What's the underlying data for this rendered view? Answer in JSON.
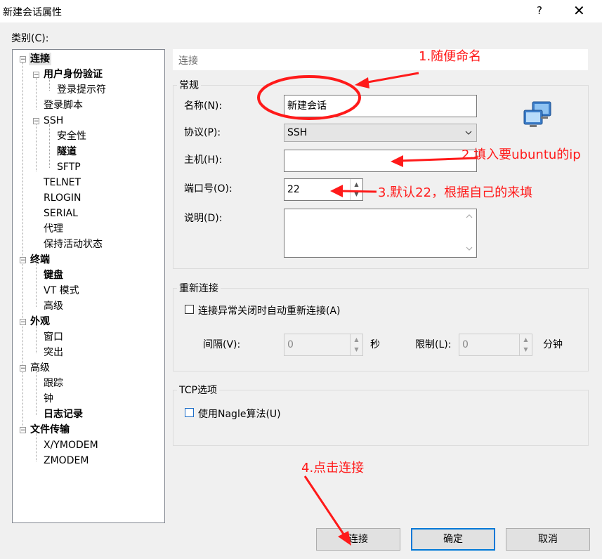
{
  "window": {
    "title": "新建会话属性",
    "help_glyph": "?",
    "close_glyph": "✕"
  },
  "category_label": "类别(C):",
  "tree": [
    {
      "label": "连接",
      "bold": true,
      "selected": true
    },
    {
      "label": "用户身份验证",
      "bold": true
    },
    {
      "label": "登录提示符"
    },
    {
      "label": "登录脚本"
    },
    {
      "label": "SSH"
    },
    {
      "label": "安全性"
    },
    {
      "label": "隧道",
      "bold": true
    },
    {
      "label": "SFTP"
    },
    {
      "label": "TELNET"
    },
    {
      "label": "RLOGIN"
    },
    {
      "label": "SERIAL"
    },
    {
      "label": "代理"
    },
    {
      "label": "保持活动状态"
    },
    {
      "label": "终端",
      "bold": true
    },
    {
      "label": "键盘",
      "bold": true
    },
    {
      "label": "VT 模式"
    },
    {
      "label": "高级"
    },
    {
      "label": "外观",
      "bold": true
    },
    {
      "label": "窗口"
    },
    {
      "label": "突出"
    },
    {
      "label": "高级"
    },
    {
      "label": "跟踪"
    },
    {
      "label": "钟"
    },
    {
      "label": "日志记录",
      "bold": true
    },
    {
      "label": "文件传输",
      "bold": true
    },
    {
      "label": "X/YMODEM"
    },
    {
      "label": "ZMODEM"
    }
  ],
  "panel_header": "连接",
  "general": {
    "title": "常规",
    "name_label": "名称(N):",
    "name_value": "新建会话",
    "protocol_label": "协议(P):",
    "protocol_value": "SSH",
    "host_label": "主机(H):",
    "host_value": "",
    "port_label": "端口号(O):",
    "port_value": "22",
    "desc_label": "说明(D):",
    "desc_value": ""
  },
  "reconnect": {
    "title": "重新连接",
    "checkbox_label": "连接异常关闭时自动重新连接(A)",
    "checked": false,
    "interval_label": "间隔(V):",
    "interval_value": "0",
    "interval_unit": "秒",
    "limit_label": "限制(L):",
    "limit_value": "0",
    "limit_unit": "分钟"
  },
  "tcp": {
    "title": "TCP选项",
    "nagle_label": "使用Nagle算法(U)",
    "nagle_checked": false
  },
  "buttons": {
    "connect": "连接",
    "ok": "确定",
    "cancel": "取消"
  },
  "annotations": {
    "a1": "1.随便命名",
    "a2": "2.填入要ubuntu的ip",
    "a3": "3.默认22，根据自己的来填",
    "a4": "4.点击连接",
    "color": "#ff1a1a"
  },
  "icons": [
    "help-icon",
    "close-icon",
    "sessions-icon",
    "chevron-down-icon",
    "spin-up-icon",
    "spin-down-icon"
  ]
}
